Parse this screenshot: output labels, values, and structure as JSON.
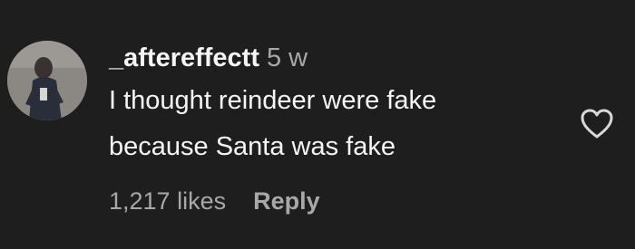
{
  "comment": {
    "username": "_aftereffectt",
    "timestamp": "5 w",
    "text_lines": [
      "I thought reindeer were fake",
      "because Santa was fake"
    ],
    "likes_label": "1,217 likes",
    "reply_label": "Reply",
    "like_icon": "heart-outline-icon"
  },
  "colors": {
    "background": "#1e1e1e",
    "primary_text": "#f5f5f5",
    "secondary_text": "#a8a8a8"
  }
}
